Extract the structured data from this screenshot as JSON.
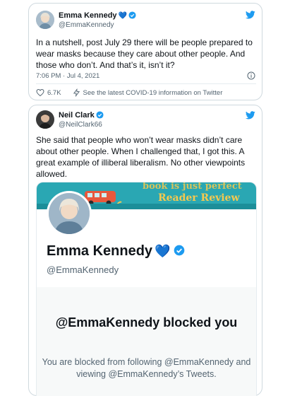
{
  "tweet1": {
    "name": "Emma Kennedy",
    "name_emoji": "💙",
    "handle": "@EmmaKennedy",
    "text": "In a nutshell, post July 29 there will be people prepared to wear masks because they care about other people. And those who don’t. And that’s it, isn’t it?",
    "timestamp": "7:06 PM · Jul 4, 2021",
    "likes": "6.7K",
    "covid_link": "See the latest COVID-19 information on Twitter"
  },
  "tweet2": {
    "name": "Neil Clark",
    "handle": "@NeilClark66",
    "text": "She said that people who won’t wear masks didn’t care about other people. When I challenged that, I got this. A great example of illiberal liberalism. No other viewpoints allowed."
  },
  "embed": {
    "banner_text_1": "book is just perfect",
    "banner_text_2": "Reader Review",
    "profile_name": "Emma Kennedy",
    "profile_emoji": "💙",
    "profile_handle": "@EmmaKennedy",
    "blocked_title": "@EmmaKennedy blocked you",
    "blocked_desc": "You are blocked from following @EmmaKennedy and viewing @EmmaKennedy’s Tweets."
  },
  "colors": {
    "twitter_blue": "#1d9bf0",
    "banner_teal": "#2aa7b3",
    "banner_gold": "#f5c94f"
  }
}
